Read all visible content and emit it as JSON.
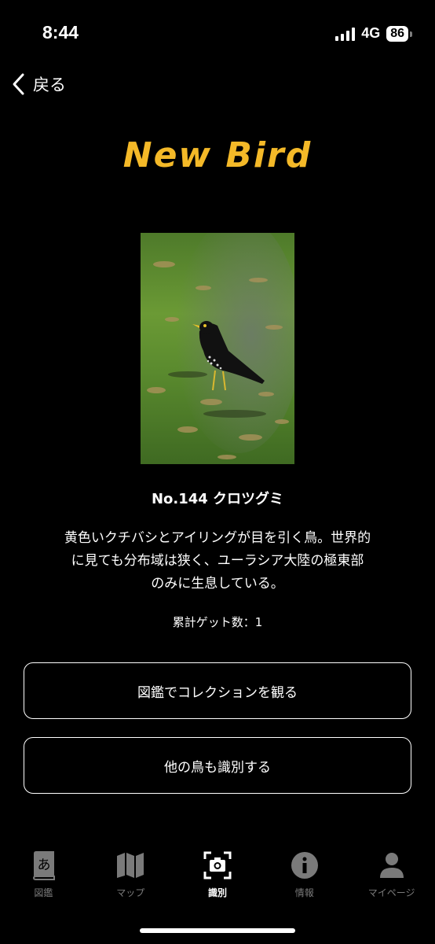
{
  "status_bar": {
    "time": "8:44",
    "network": "4G",
    "battery": "86"
  },
  "nav": {
    "back_label": "戻る"
  },
  "title": "New Bird",
  "bird": {
    "name": "No.144 クロツグミ",
    "description": "黄色いクチバシとアイリングが目を引く鳥。世界的\nに見ても分布域は狭く、ユーラシア大陸の極東部\nのみに生息している。",
    "count_text": "累計ゲット数：1"
  },
  "buttons": {
    "collection": "図鑑でコレクションを観る",
    "identify_other": "他の鳥も識別する"
  },
  "tabs": [
    {
      "label": "図鑑",
      "icon": "book-icon",
      "active": false
    },
    {
      "label": "マップ",
      "icon": "map-icon",
      "active": false
    },
    {
      "label": "識別",
      "icon": "camera-scan-icon",
      "active": true
    },
    {
      "label": "情報",
      "icon": "info-icon",
      "active": false
    },
    {
      "label": "マイページ",
      "icon": "person-icon",
      "active": false
    }
  ],
  "colors": {
    "title": "#f4b928",
    "background": "#000000",
    "inactive_tab": "#7a7a7a"
  }
}
